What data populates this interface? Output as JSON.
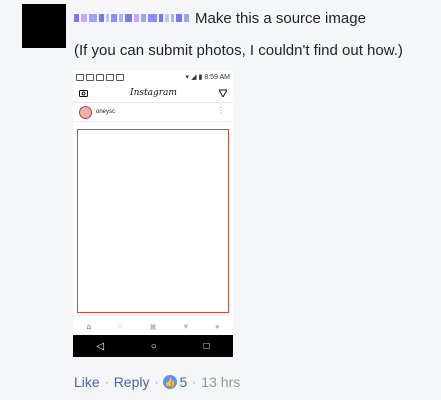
{
  "comment": {
    "text_line1": "Make this a source image",
    "text_line2": "(If you can submit photos, I couldn't find out how.)",
    "pixelated_name_colors": [
      "#7c78e8",
      "#c7a6ff",
      "#9ca2ff",
      "#6f7bff",
      "#b9c5ff",
      "#8a8dff",
      "#a6b1ff"
    ],
    "actions": {
      "like": "Like",
      "reply": "Reply",
      "reaction_count": "5",
      "time": "13 hrs"
    }
  },
  "screenshot": {
    "status_time": "8:59 AM",
    "app_title": "Instagram",
    "post_user": "oneysc",
    "nav_icons": [
      "home-icon",
      "search-icon",
      "add-icon",
      "heart-icon",
      "profile-icon"
    ],
    "android_nav": [
      "back-icon",
      "home-icon",
      "recents-icon"
    ]
  }
}
